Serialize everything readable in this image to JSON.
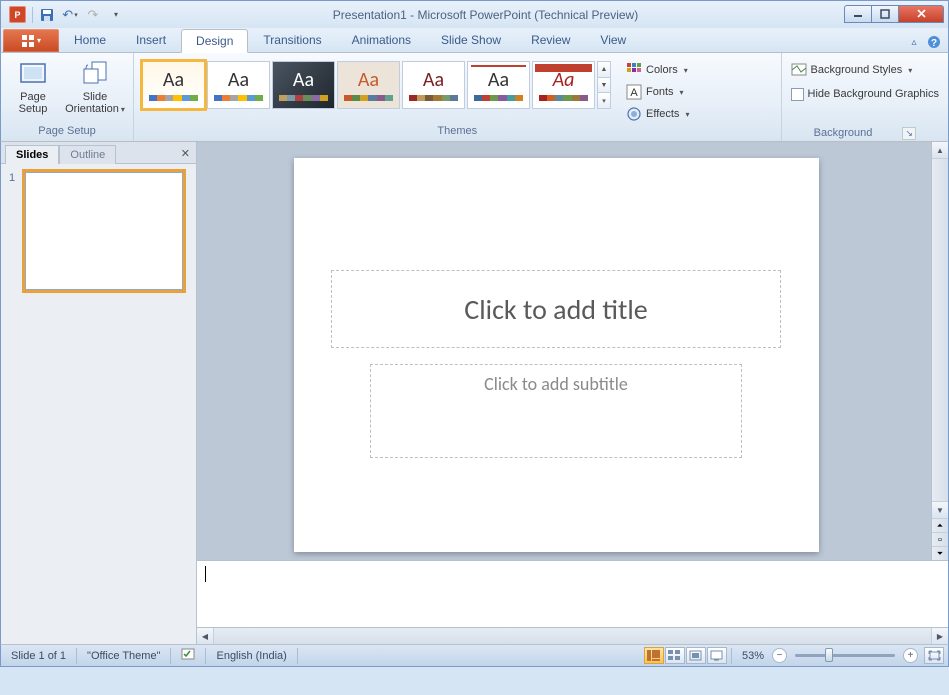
{
  "window_title": "Presentation1 - Microsoft PowerPoint (Technical Preview)",
  "qat": {
    "save": "Save",
    "undo": "Undo",
    "redo": "Redo"
  },
  "tabs": [
    "Home",
    "Insert",
    "Design",
    "Transitions",
    "Animations",
    "Slide Show",
    "Review",
    "View"
  ],
  "active_tab": "Design",
  "ribbon": {
    "page_setup_group": "Page Setup",
    "page_setup": "Page\nSetup",
    "slide_orientation": "Slide\nOrientation",
    "themes_group": "Themes",
    "colors": "Colors",
    "fonts": "Fonts",
    "effects": "Effects",
    "background_group": "Background",
    "background_styles": "Background Styles",
    "hide_bg": "Hide Background Graphics"
  },
  "side_pane": {
    "slides_tab": "Slides",
    "outline_tab": "Outline",
    "slide_num": "1"
  },
  "slide": {
    "title_placeholder": "Click to add title",
    "subtitle_placeholder": "Click to add subtitle"
  },
  "status": {
    "slide_count": "Slide 1 of 1",
    "theme": "\"Office Theme\"",
    "language": "English (India)",
    "zoom_pct": "53%"
  }
}
